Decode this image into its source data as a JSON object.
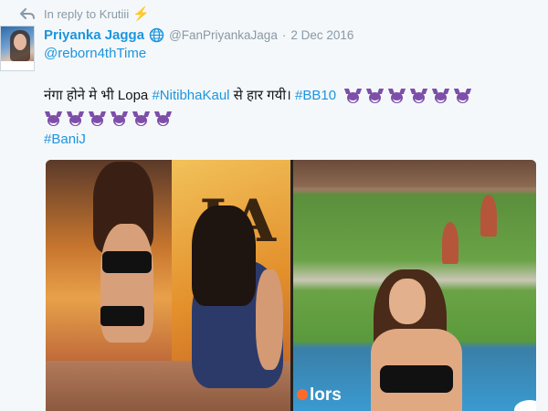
{
  "reply": {
    "label": "In reply to Krutiii",
    "bolt": "⚡"
  },
  "author": {
    "name": "Priyanka Jagga",
    "handle": "@FanPriyankaJaga",
    "separator": "·",
    "date": "2 Dec 2016"
  },
  "tweet": {
    "mention": "@reborn4thTime",
    "text_part1": "नंगा होने मे भी Lopa ",
    "hashtag1": "#NitibhaKaul",
    "text_part2": " से हार गयी। ",
    "hashtag2": "#BB10",
    "hashtag3": "#BaniJ",
    "emoji_name": "purple-imp",
    "emoji_count_row1": 6,
    "emoji_count_row2": 6
  },
  "media": {
    "watermark": "lors"
  },
  "colors": {
    "link": "#1b95e0",
    "muted": "#8899a6",
    "text": "#14171a",
    "background": "#f5f8fa"
  }
}
